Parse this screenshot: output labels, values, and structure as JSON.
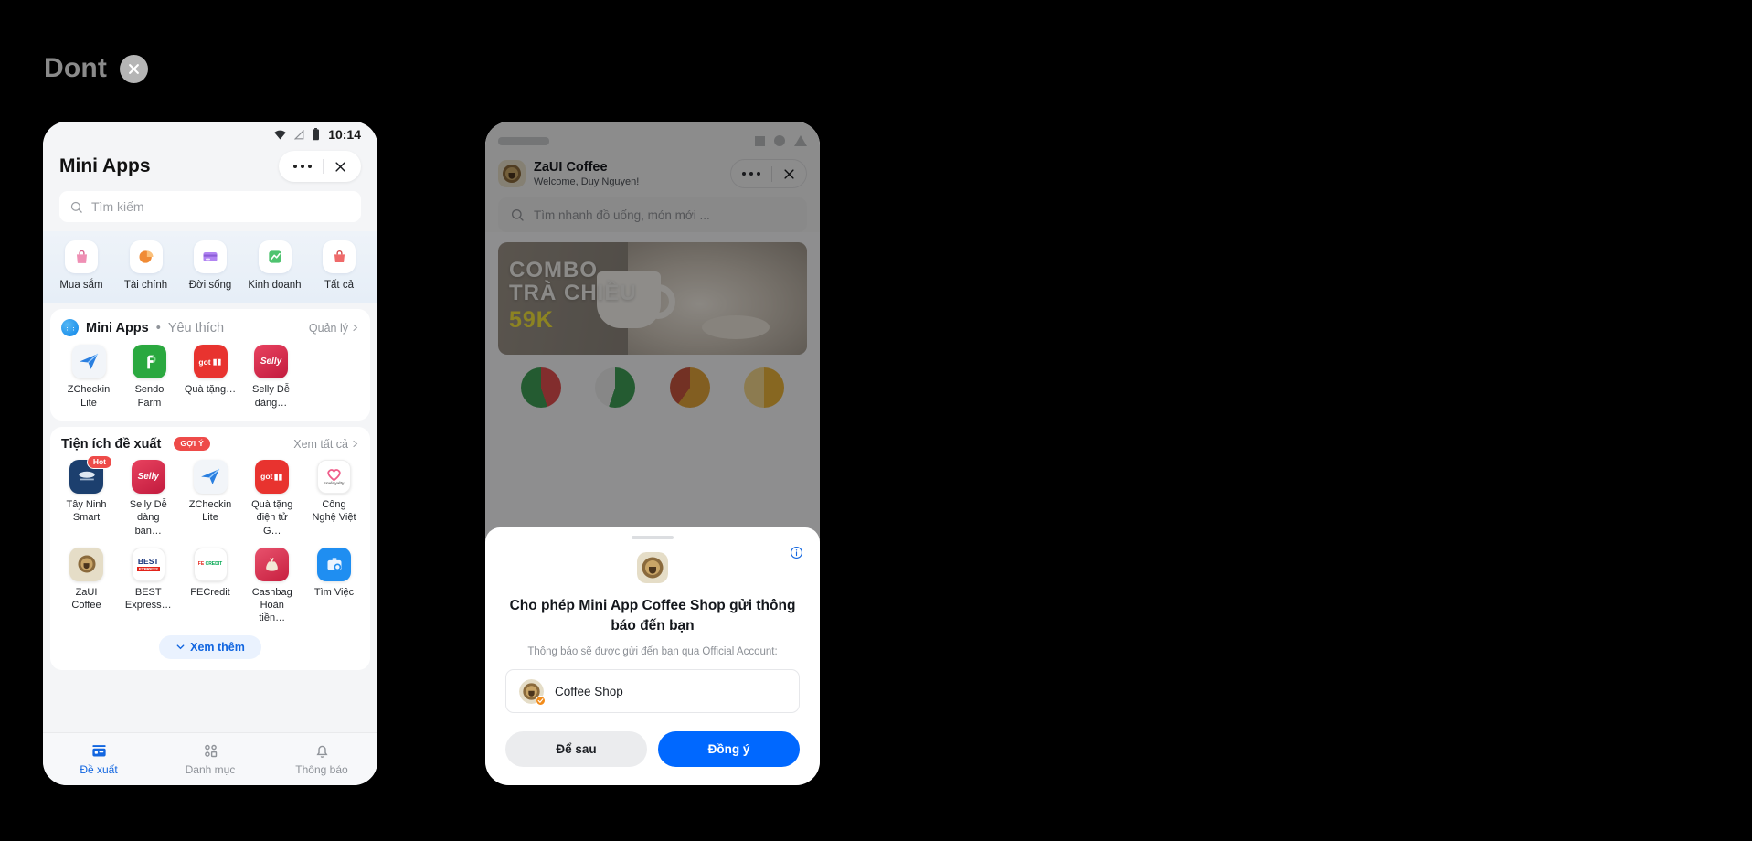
{
  "annotation": {
    "label": "Dont",
    "badge_icon": "close-circle-icon"
  },
  "left_phone": {
    "status_bar": {
      "time": "10:14",
      "icons": [
        "wifi-icon",
        "signal-off-icon",
        "battery-icon"
      ]
    },
    "header": {
      "title": "Mini Apps",
      "more_icon": "more-dots-icon",
      "close_icon": "close-icon"
    },
    "search": {
      "placeholder": "Tìm kiếm",
      "icon": "search-icon"
    },
    "categories": [
      {
        "label": "Mua sắm",
        "icon": "shopping-bag-icon",
        "color": "#e87fa8"
      },
      {
        "label": "Tài chính",
        "icon": "pie-chart-icon",
        "color": "#f5922e"
      },
      {
        "label": "Đời sống",
        "icon": "card-icon",
        "color": "#a87ef0"
      },
      {
        "label": "Kinh doanh",
        "icon": "chart-up-icon",
        "color": "#46c06a"
      },
      {
        "label": "Tất cả",
        "icon": "grid-all-icon",
        "color": "#ef5a5a"
      }
    ],
    "favorites": {
      "title": "Mini Apps",
      "separator": "•",
      "subtitle": "Yêu thích",
      "action": "Quản lý",
      "apps": [
        {
          "label": "ZCheckin Lite",
          "icon": "zcheckin-icon"
        },
        {
          "label": "Sendo Farm",
          "icon": "sendo-farm-icon"
        },
        {
          "label": "Quà tặng…",
          "icon": "gift-icon"
        },
        {
          "label": "Selly Dễ dàng…",
          "icon": "selly-icon"
        }
      ]
    },
    "suggested": {
      "title": "Tiện ích đề xuất",
      "badge": "GỢI Ý",
      "action": "Xem tất cả",
      "rows": [
        [
          {
            "label": "Tây Ninh Smart",
            "icon": "tay-ninh-smart-icon",
            "badge": "Hot"
          },
          {
            "label": "Selly Dễ dàng bán…",
            "icon": "selly-icon"
          },
          {
            "label": "ZCheckin Lite",
            "icon": "zcheckin-icon"
          },
          {
            "label": "Quà tặng điện tử G…",
            "icon": "gift-icon"
          },
          {
            "label": "Công Nghệ Việt",
            "icon": "cnvloyalty-icon"
          }
        ],
        [
          {
            "label": "ZaUI Coffee",
            "icon": "zaui-coffee-icon"
          },
          {
            "label": "BEST Express…",
            "icon": "best-express-icon"
          },
          {
            "label": "FECredit",
            "icon": "fecredit-icon"
          },
          {
            "label": "Cashbag Hoàn tiền…",
            "icon": "cashbag-icon"
          },
          {
            "label": "Tìm Việc",
            "icon": "tim-viec-icon"
          }
        ]
      ],
      "more_label": "Xem thêm"
    },
    "bottom_nav": [
      {
        "label": "Đề xuất",
        "icon": "feed-icon",
        "active": true
      },
      {
        "label": "Danh mục",
        "icon": "category-icon",
        "active": false
      },
      {
        "label": "Thông báo",
        "icon": "bell-icon",
        "active": false
      }
    ]
  },
  "right_phone": {
    "header": {
      "title": "ZaUI Coffee",
      "subtitle": "Welcome, Duy Nguyen!",
      "more_icon": "more-dots-icon",
      "close_icon": "close-icon"
    },
    "search": {
      "placeholder": "Tìm nhanh đồ uống, món mới ...",
      "icon": "search-icon"
    },
    "banner": {
      "line1": "COMBO",
      "line2": "TRÀ CHIỀU",
      "line3": "59K"
    },
    "sheet": {
      "info_icon": "info-icon",
      "app_icon": "coffee-shop-icon",
      "title": "Cho phép Mini App Coffee Shop gửi thông báo đến bạn",
      "subtitle": "Thông báo sẽ được gửi đến bạn qua Official Account:",
      "account": {
        "name": "Coffee Shop",
        "verified": true
      },
      "buttons": {
        "later": "Để sau",
        "accept": "Đồng ý"
      },
      "accent_color": "#0068ff"
    }
  }
}
